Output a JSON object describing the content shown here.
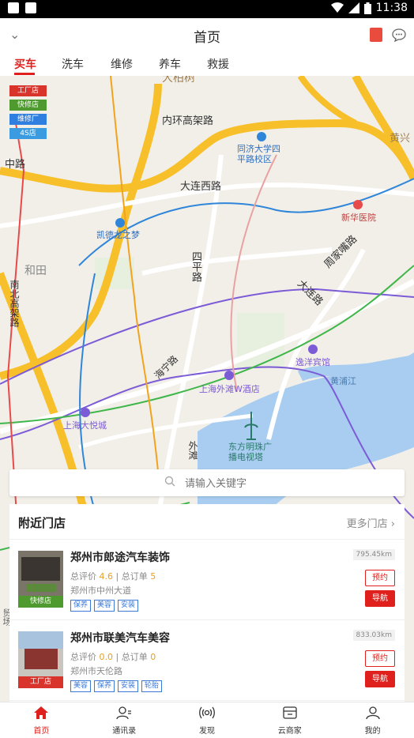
{
  "status": {
    "time": "11:38"
  },
  "header": {
    "title": "首页"
  },
  "tabs": [
    "买车",
    "洗车",
    "维修",
    "养车",
    "救援"
  ],
  "legend": [
    {
      "label": "工厂店",
      "color": "#d9342b"
    },
    {
      "label": "快修店",
      "color": "#4e9a2e"
    },
    {
      "label": "维修厂",
      "color": "#2f7fe0"
    },
    {
      "label": "4S店",
      "color": "#3b9be0"
    }
  ],
  "map_labels": {
    "l1": "大柏树",
    "l2": "内环高架路",
    "l3": "同济大学四\n平路校区",
    "l4": "黄兴",
    "l5": "中路",
    "l6": "大连西路",
    "l7": "新华医院",
    "l8": "凯德龙之梦",
    "l9": "和田",
    "l10": "四平路",
    "l11": "周家嘴路",
    "l12": "大连路",
    "l13": "南北高架路",
    "l14": "海宁路",
    "l15": "逸洋宾馆",
    "l16": "上海外滩W酒店",
    "l17": "黄浦江",
    "l18": "上海大悦城",
    "l19": "东方明珠广\n播电视塔",
    "l20": "外滩",
    "l21": "贸场"
  },
  "search": {
    "placeholder": "请输入关键字"
  },
  "nearby": {
    "title": "附近门店",
    "more": "更多门店",
    "stores": [
      {
        "name": "郑州市郎途汽车装饰",
        "rating_label": "总评价",
        "rating": "4.6",
        "orders_label": "总订单",
        "orders": "5",
        "address": "郑州市中州大道",
        "tags": [
          "保养",
          "美容",
          "安装"
        ],
        "distance": "795.45km",
        "type": "快修店",
        "type_color": "#4e9a2e",
        "book": "预约",
        "nav": "导航"
      },
      {
        "name": "郑州市联美汽车美容",
        "rating_label": "总评价",
        "rating": "0.0",
        "orders_label": "总订单",
        "orders": "0",
        "address": "郑州市天伦路",
        "tags": [
          "美容",
          "保养",
          "安装",
          "轮胎"
        ],
        "distance": "833.03km",
        "type": "工厂店",
        "type_color": "#d9342b",
        "book": "预约",
        "nav": "导航"
      }
    ]
  },
  "bottom_nav": [
    {
      "label": "首页",
      "icon": "home-icon"
    },
    {
      "label": "通讯录",
      "icon": "contacts-icon"
    },
    {
      "label": "发现",
      "icon": "broadcast-icon"
    },
    {
      "label": "云商家",
      "icon": "store-icon"
    },
    {
      "label": "我的",
      "icon": "user-icon"
    }
  ],
  "colors": {
    "accent": "#e0201c",
    "map_bg": "#f2efe9",
    "water": "#a8cdf0",
    "road_yellow": "#f7c02a"
  }
}
